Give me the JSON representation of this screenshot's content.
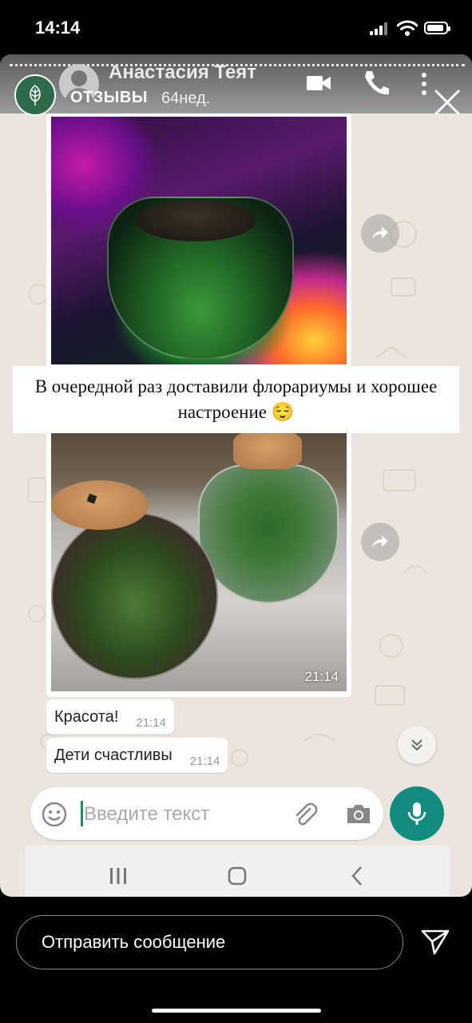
{
  "status_bar": {
    "time": "14:14"
  },
  "story": {
    "account_label": "ОТЗЫВЫ",
    "reply_placeholder": "Отправить сообщение",
    "caption": "В очередной раз доставили  флорариумы и хорошее настроение 😌"
  },
  "chat": {
    "contact_name": "Анастасия Теят",
    "last_seen": "64нед.",
    "photo_time": "21:14",
    "messages": [
      {
        "text": "Красота!",
        "time": "21:14"
      },
      {
        "text": "Дети счастливы",
        "time": "21:14"
      }
    ],
    "input_placeholder": "Введите текст"
  },
  "colors": {
    "whatsapp_green": "#128c7e",
    "chat_background": "#ece5dd",
    "story_logo_green": "#2e6b4b"
  },
  "icons": [
    "signal-icon",
    "wifi-icon",
    "battery-icon",
    "leaf-logo-icon",
    "video-call-icon",
    "phone-icon",
    "more-icon",
    "close-icon",
    "forward-icon",
    "scroll-down-icon",
    "emoji-icon",
    "attach-icon",
    "camera-icon",
    "mic-icon",
    "recent-apps-icon",
    "home-icon",
    "back-icon",
    "send-icon"
  ]
}
